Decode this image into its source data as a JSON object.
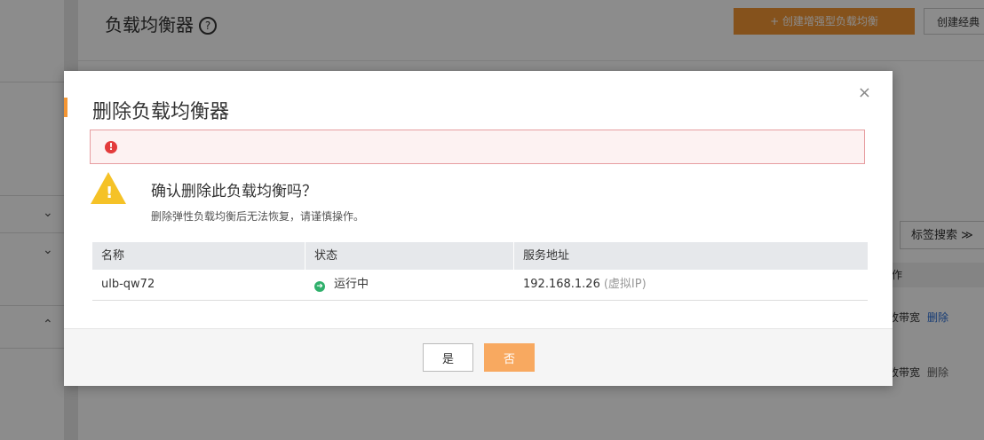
{
  "background": {
    "page_title": "负载均衡器",
    "help_icon": "?",
    "create_enhanced_button": "+ 创建增强型负载均衡",
    "create_classic_button": "创建经典",
    "tag_search": "标签搜索 ≫",
    "table_header_op": "作",
    "row1_ops": {
      "bandwidth": "改带宽",
      "delete": "删除"
    },
    "row2_ops": {
      "bandwidth": "改带宽",
      "delete": "删除"
    },
    "sidebar_chevrons": [
      "⌄",
      "⌄",
      "⌃"
    ]
  },
  "modal": {
    "title": "删除负载均衡器",
    "close_icon": "×",
    "alert_icon": "!",
    "warning_icon": "!",
    "confirm_title": "确认删除此负载均衡吗？",
    "confirm_subtitle": "删除弹性负载均衡后无法恢复，请谨慎操作。",
    "table": {
      "headers": [
        "名称",
        "状态",
        "服务地址"
      ],
      "rows": [
        {
          "name": "ulb-qw72",
          "status_icon": "➜",
          "status": "运行中",
          "address": "192.168.1.26",
          "address_note": "(虚拟IP)"
        }
      ]
    },
    "buttons": {
      "yes": "是",
      "no": "否"
    }
  },
  "colors": {
    "accent": "#f39533",
    "alert_red": "#e33c3c",
    "warning_yellow": "#f5c227",
    "running_green": "#2fb06b",
    "link_blue": "#2a6ed6"
  }
}
